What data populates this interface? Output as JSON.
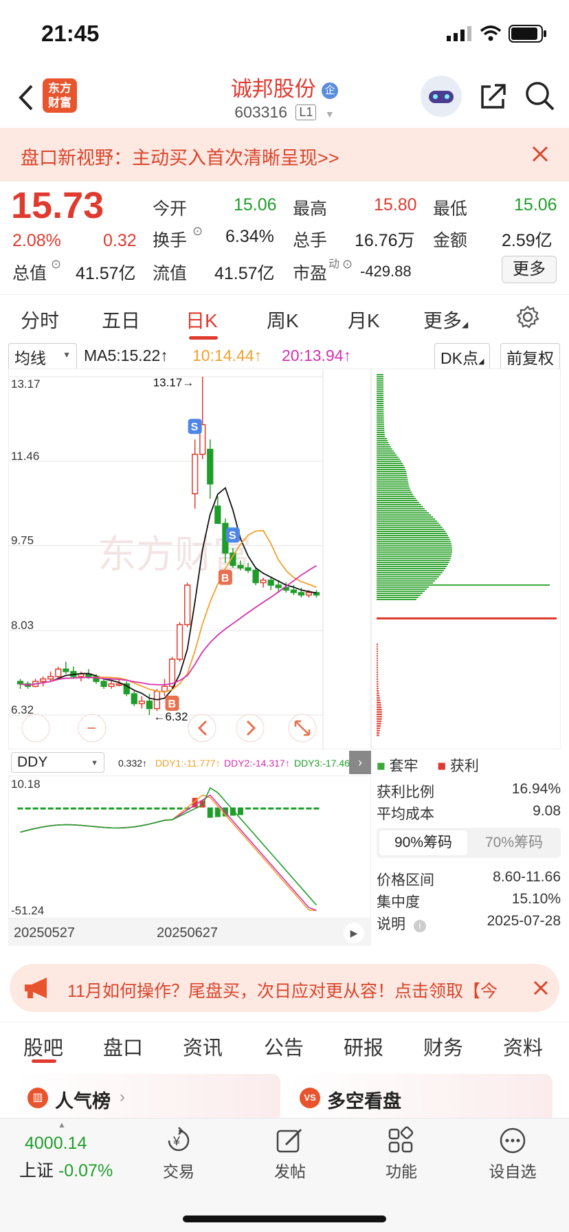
{
  "status_bar": {
    "time": "21:45"
  },
  "header": {
    "stock_name": "诚邦股份",
    "qi_badge": "企",
    "stock_code": "603316",
    "level": "L1",
    "logo_text": "东方财富"
  },
  "banner": {
    "text": "盘口新视野：主动买入首次清晰呈现>>"
  },
  "quote": {
    "price": "15.73",
    "change_pct": "2.08%",
    "change_amt": "0.32",
    "open_label": "今开",
    "open": "15.06",
    "high_label": "最高",
    "high": "15.80",
    "low_label": "最低",
    "low": "15.06",
    "turnover_label": "换手",
    "turnover": "6.34%",
    "volume_label": "总手",
    "volume": "16.76万",
    "amount_label": "金额",
    "amount": "2.59亿",
    "mktcap_label": "总值",
    "mktcap": "41.57亿",
    "float_label": "流值",
    "float": "41.57亿",
    "pe_label": "市盈",
    "pe_sup": "动",
    "pe": "-429.88",
    "more_label": "更多"
  },
  "period_tabs": [
    "分时",
    "五日",
    "日K",
    "周K",
    "月K",
    "更多"
  ],
  "ma_row": {
    "selector": "均线",
    "ma5": "MA5:15.22↑",
    "ma10": "10:14.44↑",
    "ma20": "20:13.94↑",
    "dk_button": "DK点",
    "fq_button": "前复权"
  },
  "chart_data": [
    {
      "type": "candlestick",
      "y_ticks": [
        "13.17",
        "11.46",
        "9.75",
        "8.03",
        "6.32"
      ],
      "ylim": [
        6.32,
        13.17
      ],
      "high_annotation": "13.17→",
      "low_annotation": "←6.32",
      "x_ticks": [
        "20250527",
        "20250627"
      ],
      "watermark": "东方财富",
      "markers": [
        "S",
        "S",
        "B",
        "B"
      ],
      "candles": [
        [
          7.0,
          7.05,
          6.85,
          6.95
        ],
        [
          6.95,
          7.0,
          6.85,
          6.9
        ],
        [
          6.9,
          7.05,
          6.88,
          7.0
        ],
        [
          7.0,
          7.1,
          6.9,
          7.05
        ],
        [
          7.05,
          7.2,
          7.0,
          7.1
        ],
        [
          7.1,
          7.3,
          7.05,
          7.25
        ],
        [
          7.25,
          7.4,
          7.15,
          7.2
        ],
        [
          7.2,
          7.3,
          7.05,
          7.1
        ],
        [
          7.1,
          7.2,
          7.0,
          7.15
        ],
        [
          7.15,
          7.25,
          7.05,
          7.1
        ],
        [
          7.1,
          7.15,
          6.95,
          7.0
        ],
        [
          7.0,
          7.05,
          6.85,
          6.9
        ],
        [
          6.9,
          7.0,
          6.85,
          6.95
        ],
        [
          6.95,
          7.05,
          6.9,
          6.95
        ],
        [
          6.95,
          7.0,
          6.7,
          6.75
        ],
        [
          6.75,
          6.8,
          6.5,
          6.55
        ],
        [
          6.55,
          6.7,
          6.45,
          6.6
        ],
        [
          6.6,
          6.75,
          6.32,
          6.45
        ],
        [
          6.45,
          6.85,
          6.4,
          6.8
        ],
        [
          6.8,
          7.05,
          6.7,
          6.9
        ],
        [
          6.9,
          7.5,
          6.85,
          7.45
        ],
        [
          7.45,
          8.2,
          7.4,
          8.15
        ],
        [
          8.15,
          9.0,
          8.1,
          8.95
        ],
        [
          10.8,
          11.9,
          10.5,
          11.6
        ],
        [
          11.6,
          13.17,
          11.5,
          12.2
        ],
        [
          11.7,
          11.9,
          10.7,
          11.0
        ],
        [
          10.55,
          10.75,
          10.2,
          10.2
        ],
        [
          10.2,
          10.3,
          9.4,
          9.6
        ],
        [
          9.6,
          9.7,
          9.3,
          9.35
        ],
        [
          9.35,
          9.45,
          9.25,
          9.3
        ],
        [
          9.3,
          9.4,
          9.2,
          9.25
        ],
        [
          9.25,
          9.3,
          8.95,
          9.0
        ],
        [
          9.0,
          9.1,
          8.9,
          9.05
        ],
        [
          9.05,
          9.1,
          8.85,
          8.95
        ],
        [
          8.95,
          9.05,
          8.8,
          8.9
        ],
        [
          8.9,
          9.0,
          8.8,
          8.85
        ],
        [
          8.85,
          8.95,
          8.75,
          8.8
        ],
        [
          8.8,
          8.9,
          8.7,
          8.75
        ],
        [
          8.75,
          8.85,
          8.7,
          8.8
        ],
        [
          8.8,
          8.85,
          8.7,
          8.75
        ]
      ]
    },
    {
      "type": "line",
      "name": "DDY",
      "selector": "DDY",
      "readout": [
        "0.332↑",
        "DDY1:-11.777↑",
        "DDY2:-14.317↑",
        "DDY3:-17.467↑"
      ],
      "y_ticks": [
        "10.18",
        "-51.24"
      ],
      "ylim": [
        -51.24,
        10.18
      ]
    }
  ],
  "chip_panel": {
    "legend_a": "套牢",
    "legend_b": "获利",
    "profit_ratio_label": "获利比例",
    "profit_ratio": "16.94%",
    "avg_cost_label": "平均成本",
    "avg_cost": "9.08",
    "tab_90": "90%筹码",
    "tab_70": "70%筹码",
    "price_range_label": "价格区间",
    "price_range": "8.60-11.66",
    "concentration_label": "集中度",
    "concentration": "15.10%",
    "note_label": "说明",
    "note_date": "2025-07-28"
  },
  "promo": {
    "text": "11月如何操作？尾盘买，次日应对更从容！点击领取【今"
  },
  "bottom_tabs": [
    "股吧",
    "盘口",
    "资讯",
    "公告",
    "研报",
    "财务",
    "资料"
  ],
  "cards": {
    "left_title": "人气榜",
    "right_title": "多空看盘"
  },
  "bottom_nav": {
    "index_value": "4000.14",
    "index_name": "上证",
    "index_change": "-0.07%",
    "trade": "交易",
    "post": "发帖",
    "func": "功能",
    "watch": "设自选"
  },
  "colors": {
    "up": "#e03a2f",
    "down": "#1f9d2a",
    "ma10": "#f0a02c",
    "ma20": "#d42fb0"
  }
}
